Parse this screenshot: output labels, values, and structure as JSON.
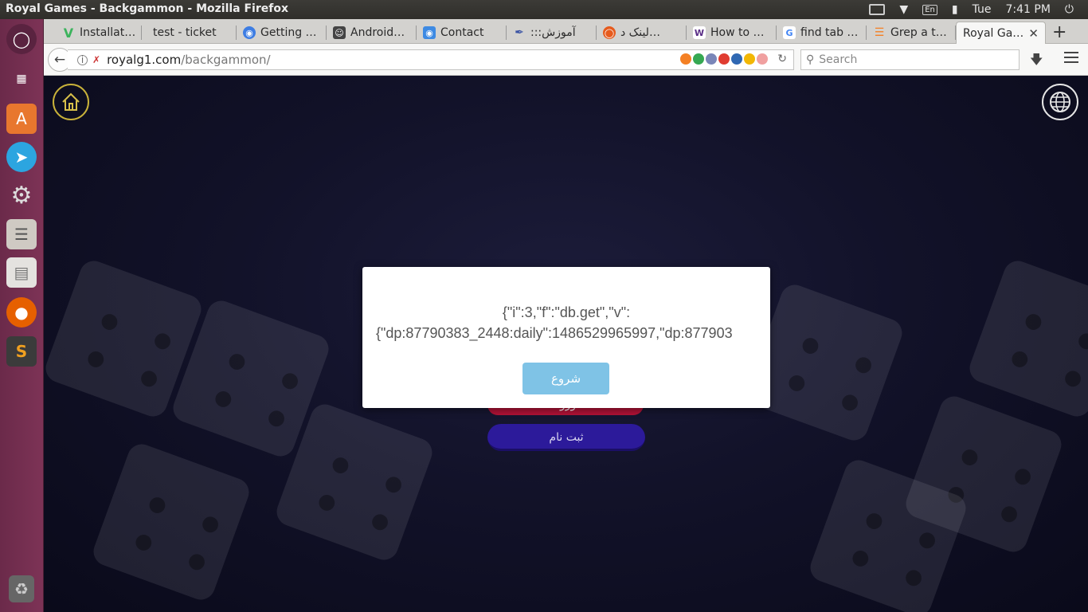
{
  "window": {
    "title": "Royal Games - Backgammon - Mozilla Firefox"
  },
  "tray": {
    "keyboard": "En",
    "day": "Tue",
    "time": "7:41 PM"
  },
  "tabs": [
    {
      "label": "Installat…",
      "icon_color": "#3bb35c"
    },
    {
      "label": "test - ticket",
      "icon_color": ""
    },
    {
      "label": "Getting …",
      "icon_color": "#3d7de3"
    },
    {
      "label": "Android…",
      "icon_color": "#444444"
    },
    {
      "label": "Contact",
      "icon_color": "#3d8ae3"
    },
    {
      "label": ":::آموزش",
      "icon_color": "#3a53a4"
    },
    {
      "label": "لینک د…",
      "icon_color": "#e65b1d"
    },
    {
      "label": "How to …",
      "icon_color": "#5a2e86"
    },
    {
      "label": "find tab …",
      "icon_color": "#4285f4"
    },
    {
      "label": "Grep a t…",
      "icon_color": "#f48024"
    },
    {
      "label": "Royal Ga…",
      "active": true
    }
  ],
  "navbar": {
    "url_host": "royalg1.com",
    "url_path": "/backgammon/",
    "search_placeholder": "Search"
  },
  "page": {
    "red_button_label": "ورود",
    "register_button_label": "ثبت نام"
  },
  "modal": {
    "message_line1": "{\"i\":3,\"f\":\"db.get\",\"v\":",
    "message_line2": "{\"dp:87790383_2448:daily\":1486529965997,\"dp:877903",
    "button_label": "شروع"
  },
  "colors": {
    "launcher": "#7d3356",
    "modal_button": "#7fc3e6",
    "register_button": "#2c1a9a",
    "login_button": "#b01236"
  }
}
